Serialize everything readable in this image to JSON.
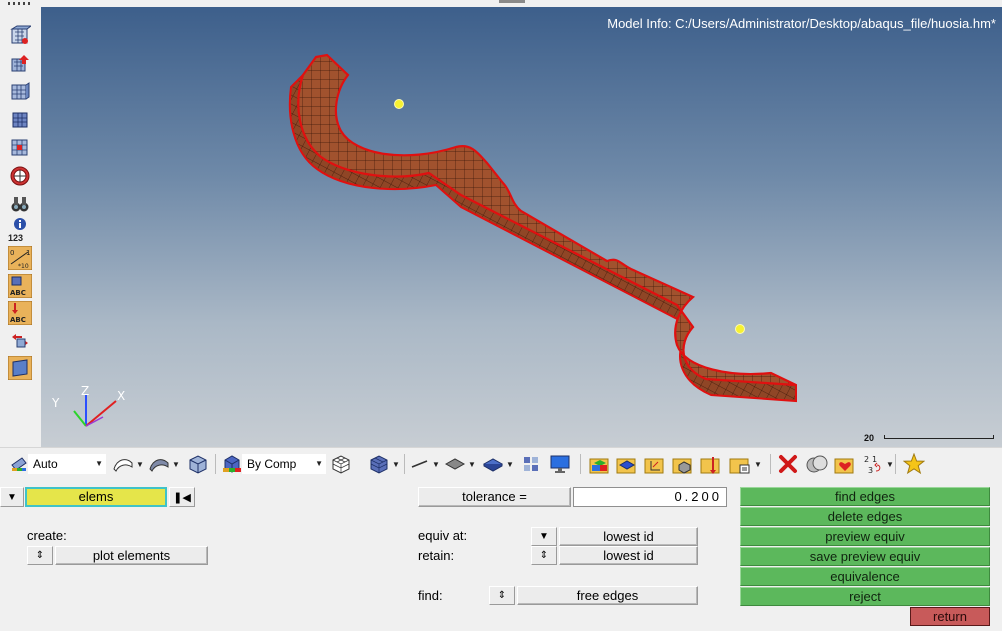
{
  "viewport": {
    "model_info": "Model Info: C:/Users/Administrator/Desktop/abaqus_file/huosia.hm*",
    "scale_label": "20",
    "axes": {
      "x": "X",
      "y": "Y",
      "z": "Z"
    },
    "left_toolbar_number": "123",
    "mesh_color": "#a1522e",
    "edge_color": "#e01010",
    "gradient_top": "#3d5f8b",
    "gradient_bottom": "#c7cdd3"
  },
  "toolbar": {
    "auto_label": "Auto",
    "by_comp_label": "By Comp",
    "icons": [
      "view-icon",
      "surface-display-icon",
      "shaded-display-icon",
      "cube-icon",
      "component-color-icon",
      "wireframe-icon",
      "shaded-cube-icon",
      "line-icon",
      "plane-icon",
      "solid-plane-icon",
      "grid-icon",
      "monitor-icon",
      "components-icon",
      "collector-icon",
      "folder-axis-icon",
      "folder-cube-icon",
      "folder-flag-icon",
      "folder-export-icon",
      "delete-x-icon",
      "mask-icon",
      "folder-heart-icon",
      "renumber-icon",
      "favorite-star-icon"
    ]
  },
  "panel": {
    "entity_selector": "elems",
    "create_label": "create:",
    "plot_elements": "plot elements",
    "tolerance_label": "tolerance =",
    "tolerance_value": "0.200",
    "equiv_at_label": "equiv at:",
    "equiv_at_value": "lowest id",
    "retain_label": "retain:",
    "retain_value": "lowest id",
    "find_label": "find:",
    "find_value": "free edges",
    "actions": [
      "find edges",
      "delete edges",
      "preview equiv",
      "save preview equiv",
      "equivalence",
      "reject"
    ],
    "return_label": "return",
    "action_color": "#5cb85c",
    "return_color": "#c85a5a"
  }
}
